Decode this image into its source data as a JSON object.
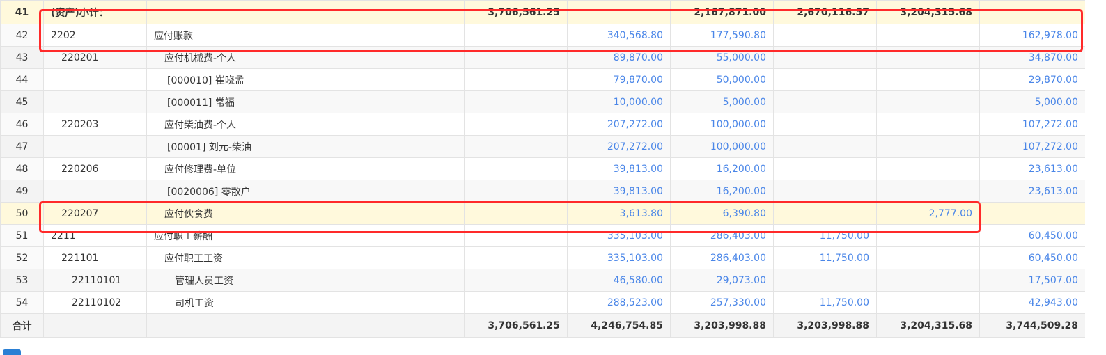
{
  "rows": [
    {
      "no": "41",
      "code": "",
      "name": "(资产)小计：",
      "c1": "3,706,561.25",
      "c2": "",
      "c3": "2,167,871.00",
      "c4": "2,670,116.57",
      "c5": "3,204,315.68",
      "c6": ""
    },
    {
      "no": "42",
      "code": "2202",
      "name": "应付账款",
      "c1": "",
      "c2": "340,568.80",
      "c3": "177,590.80",
      "c4": "",
      "c5": "",
      "c6": "162,978.00"
    },
    {
      "no": "43",
      "code": "220201",
      "name": "应付机械费-个人",
      "c1": "",
      "c2": "89,870.00",
      "c3": "55,000.00",
      "c4": "",
      "c5": "",
      "c6": "34,870.00"
    },
    {
      "no": "44",
      "code": "",
      "name": "[000010] 崔晓孟",
      "c1": "",
      "c2": "79,870.00",
      "c3": "50,000.00",
      "c4": "",
      "c5": "",
      "c6": "29,870.00"
    },
    {
      "no": "45",
      "code": "",
      "name": "[000011] 常福",
      "c1": "",
      "c2": "10,000.00",
      "c3": "5,000.00",
      "c4": "",
      "c5": "",
      "c6": "5,000.00"
    },
    {
      "no": "46",
      "code": "220203",
      "name": "应付柴油费-个人",
      "c1": "",
      "c2": "207,272.00",
      "c3": "100,000.00",
      "c4": "",
      "c5": "",
      "c6": "107,272.00"
    },
    {
      "no": "47",
      "code": "",
      "name": "[00001] 刘元-柴油",
      "c1": "",
      "c2": "207,272.00",
      "c3": "100,000.00",
      "c4": "",
      "c5": "",
      "c6": "107,272.00"
    },
    {
      "no": "48",
      "code": "220206",
      "name": "应付修理费-单位",
      "c1": "",
      "c2": "39,813.00",
      "c3": "16,200.00",
      "c4": "",
      "c5": "",
      "c6": "23,613.00"
    },
    {
      "no": "49",
      "code": "",
      "name": "[0020006] 零散户",
      "c1": "",
      "c2": "39,813.00",
      "c3": "16,200.00",
      "c4": "",
      "c5": "",
      "c6": "23,613.00"
    },
    {
      "no": "50",
      "code": "220207",
      "name": "应付伙食费",
      "c1": "",
      "c2": "3,613.80",
      "c3": "6,390.80",
      "c4": "",
      "c5": "2,777.00",
      "c6": ""
    },
    {
      "no": "51",
      "code": "2211",
      "name": "应付职工薪酬",
      "c1": "",
      "c2": "335,103.00",
      "c3": "286,403.00",
      "c4": "11,750.00",
      "c5": "",
      "c6": "60,450.00"
    },
    {
      "no": "52",
      "code": "221101",
      "name": "应付职工工资",
      "c1": "",
      "c2": "335,103.00",
      "c3": "286,403.00",
      "c4": "11,750.00",
      "c5": "",
      "c6": "60,450.00"
    },
    {
      "no": "53",
      "code": "22110101",
      "name": "管理人员工资",
      "c1": "",
      "c2": "46,580.00",
      "c3": "29,073.00",
      "c4": "",
      "c5": "",
      "c6": "17,507.00"
    },
    {
      "no": "54",
      "code": "22110102",
      "name": "司机工资",
      "c1": "",
      "c2": "288,523.00",
      "c3": "257,330.00",
      "c4": "11,750.00",
      "c5": "",
      "c6": "42,943.00"
    }
  ],
  "total": {
    "label": "合计",
    "c1": "3,706,561.25",
    "c2": "4,246,754.85",
    "c3": "3,203,998.88",
    "c4": "3,203,998.88",
    "c5": "3,204,315.68",
    "c6": "3,744,509.28"
  },
  "colors": {
    "amount_blue": "#4a86e8",
    "highlight_red": "#ff2a2a",
    "subtotal_bg": "#fff9dc"
  }
}
